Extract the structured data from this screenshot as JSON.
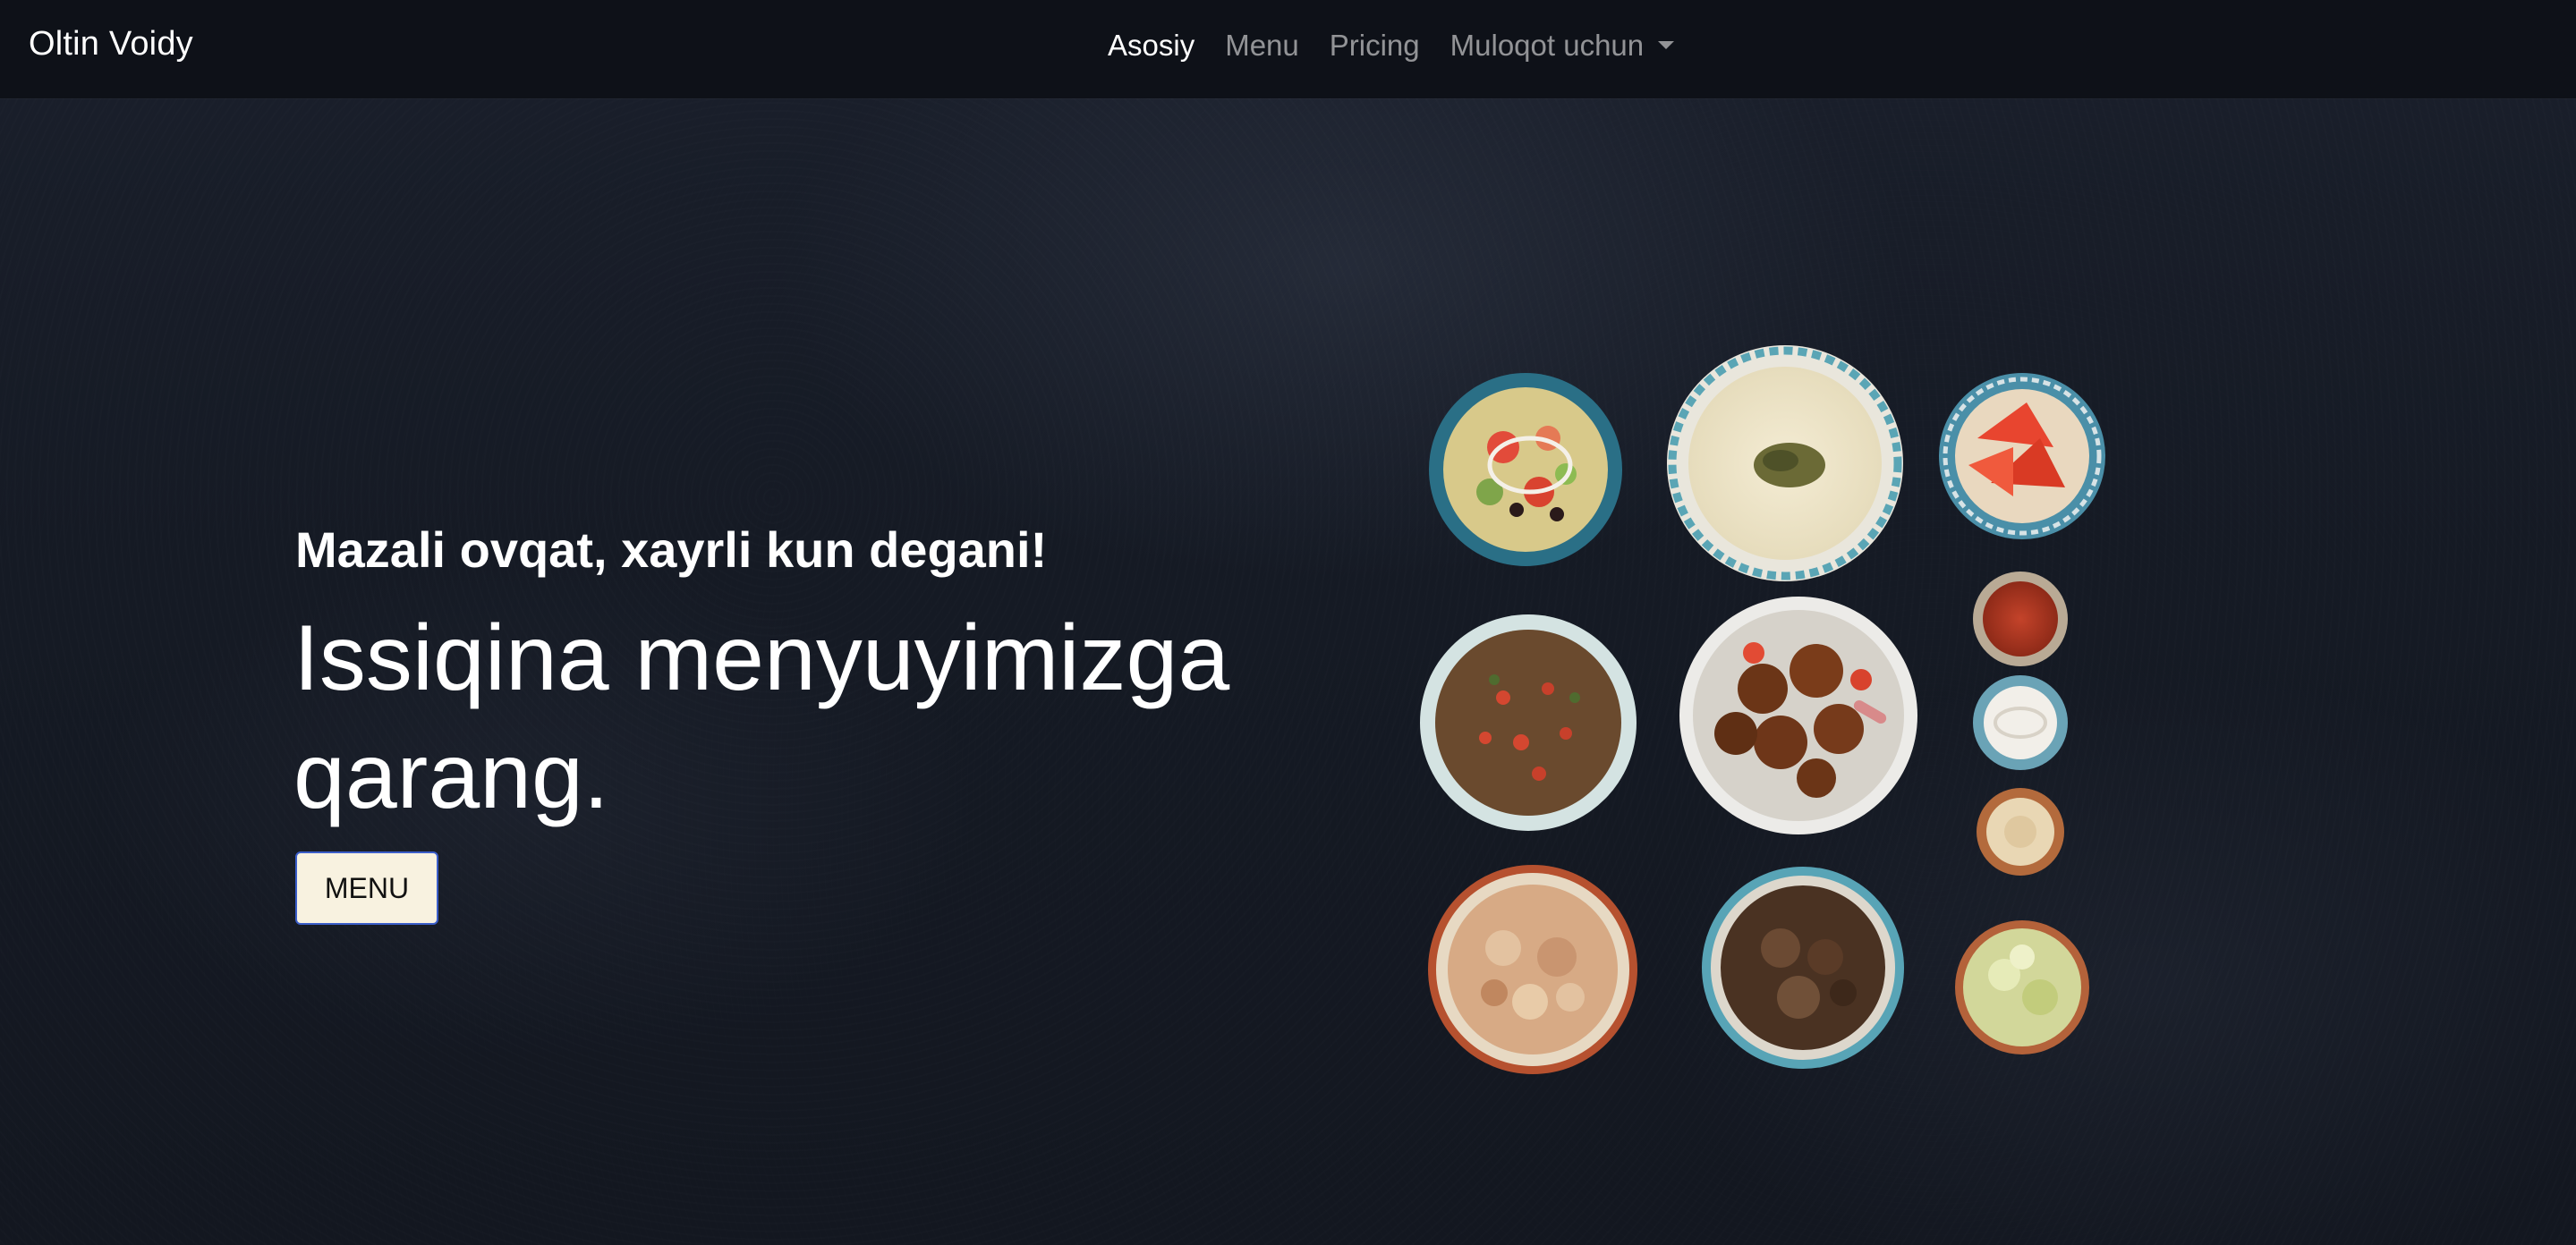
{
  "navbar": {
    "brand": "Oltin Voidy",
    "links": [
      {
        "label": "Asosiy",
        "active": true
      },
      {
        "label": "Menu",
        "active": false
      },
      {
        "label": "Pricing",
        "active": false
      },
      {
        "label": "Muloqot uchun",
        "active": false,
        "dropdown": true
      }
    ]
  },
  "hero": {
    "subtitle": "Mazali ovqat, xayrli kun degani!",
    "title": "Issiqina menyuyimizga qarang.",
    "button_label": "MENU",
    "image_icon": "food-bowls-image"
  },
  "colors": {
    "background": "#141923",
    "navbar": "#0e1118",
    "button_bg": "#f8f2e0",
    "button_border": "#3b5ec9",
    "text": "#ffffff"
  }
}
